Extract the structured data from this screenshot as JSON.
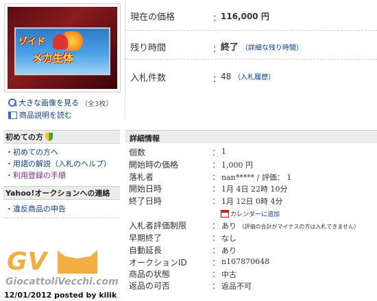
{
  "item": {
    "image_alt_title1": "ゾイド",
    "image_alt_title2": "メカ生体",
    "view_large": "大きな画像を見る",
    "view_large_count": "（全3枚）",
    "read_desc": "商品説明を読む"
  },
  "summary": {
    "price_label": "現在の価格",
    "price_value": "116,000 円",
    "time_label": "残り時間",
    "time_value": "終了",
    "time_link": "（詳細な残り時間）",
    "bids_label": "入札件数",
    "bids_value": "48",
    "bids_link": "（入札履歴）",
    "colon": "："
  },
  "sidebar": {
    "first_head": "初めての方",
    "first_items": [
      "初めての方へ",
      "用語の解説（入札のヘルプ）",
      "利用登録の手順"
    ],
    "contact_head": "Yahoo!オークションへの連絡",
    "contact_items": [
      "違反商品の申告"
    ]
  },
  "details": {
    "header": "詳細情報",
    "rows": [
      {
        "label": "個数",
        "value": "1"
      },
      {
        "label": "開始時の価格",
        "value": "1,000 円"
      },
      {
        "label": "落札者",
        "value": "nan***** / 評価： 1"
      },
      {
        "label": "開始日時",
        "value": "1月 4日 22時 10分"
      },
      {
        "label": "終了日時",
        "value": "1月 12日 0時 4分"
      },
      {
        "label": "入札者評価制限",
        "value": "あり",
        "note": "（評価の合計がマイナスの方は入札できません）"
      },
      {
        "label": "早期終了",
        "value": "なし"
      },
      {
        "label": "自動延長",
        "value": "あり"
      },
      {
        "label": "オークションID",
        "value": "n107870648"
      },
      {
        "label": "商品の状態",
        "value": "中古"
      },
      {
        "label": "返品の可否",
        "value": "返品不可"
      }
    ],
    "calendar_link": "カレンダーに追加"
  },
  "watermark": {
    "logo": "GV",
    "site": "GiocattoliVecchi.com",
    "posted": "12/01/2012 posted by kilik"
  },
  "colors": {
    "link": "#0b3f93",
    "watermark": "#f0a021"
  }
}
